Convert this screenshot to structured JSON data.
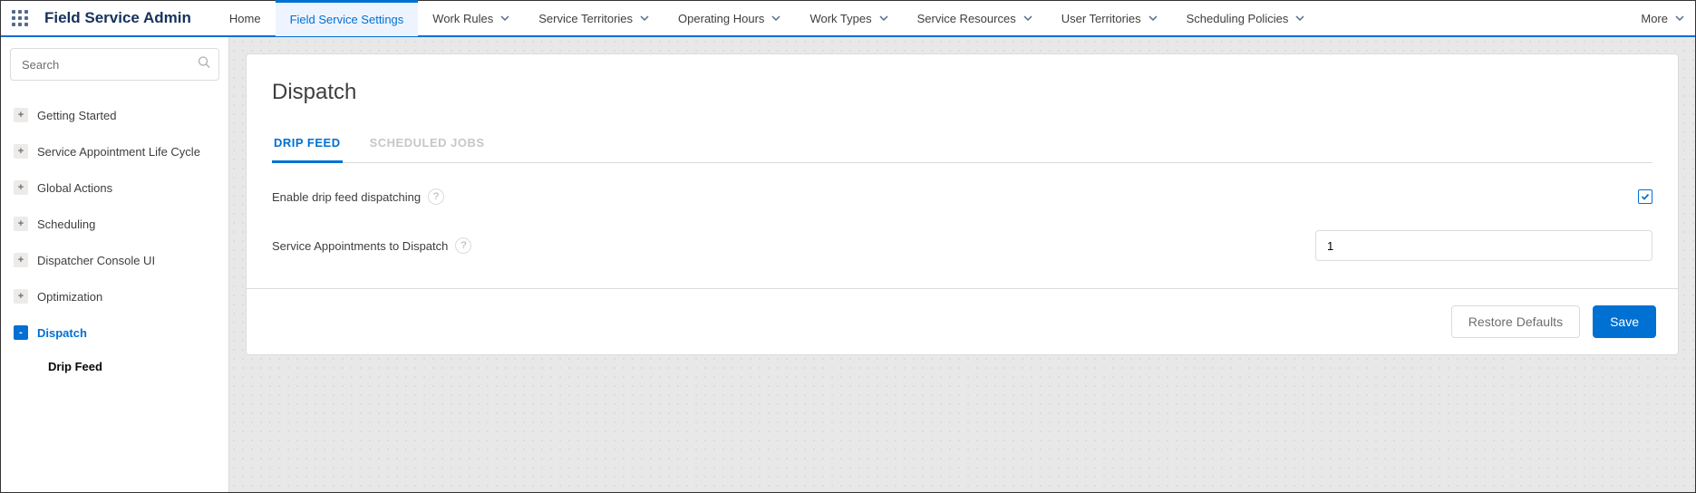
{
  "header": {
    "appTitle": "Field Service Admin",
    "tabs": [
      {
        "label": "Home",
        "hasDropdown": false,
        "active": false
      },
      {
        "label": "Field Service Settings",
        "hasDropdown": false,
        "active": true
      },
      {
        "label": "Work Rules",
        "hasDropdown": true,
        "active": false
      },
      {
        "label": "Service Territories",
        "hasDropdown": true,
        "active": false
      },
      {
        "label": "Operating Hours",
        "hasDropdown": true,
        "active": false
      },
      {
        "label": "Work Types",
        "hasDropdown": true,
        "active": false
      },
      {
        "label": "Service Resources",
        "hasDropdown": true,
        "active": false
      },
      {
        "label": "User Territories",
        "hasDropdown": true,
        "active": false
      },
      {
        "label": "Scheduling Policies",
        "hasDropdown": true,
        "active": false
      }
    ],
    "moreLabel": "More"
  },
  "sidebar": {
    "searchPlaceholder": "Search",
    "items": [
      {
        "label": "Getting Started",
        "expanded": false,
        "active": false
      },
      {
        "label": "Service Appointment Life Cycle",
        "expanded": false,
        "active": false
      },
      {
        "label": "Global Actions",
        "expanded": false,
        "active": false
      },
      {
        "label": "Scheduling",
        "expanded": false,
        "active": false
      },
      {
        "label": "Dispatcher Console UI",
        "expanded": false,
        "active": false
      },
      {
        "label": "Optimization",
        "expanded": false,
        "active": false
      },
      {
        "label": "Dispatch",
        "expanded": true,
        "active": true,
        "children": [
          {
            "label": "Drip Feed"
          }
        ]
      }
    ]
  },
  "main": {
    "title": "Dispatch",
    "subtabs": [
      {
        "label": "Drip Feed",
        "active": true
      },
      {
        "label": "Scheduled Jobs",
        "active": false
      }
    ],
    "fields": {
      "enableDripFeed": {
        "label": "Enable drip feed dispatching",
        "checked": true
      },
      "appointmentsToDispatch": {
        "label": "Service Appointments to Dispatch",
        "value": "1"
      }
    },
    "buttons": {
      "restoreDefaults": "Restore Defaults",
      "save": "Save"
    }
  }
}
